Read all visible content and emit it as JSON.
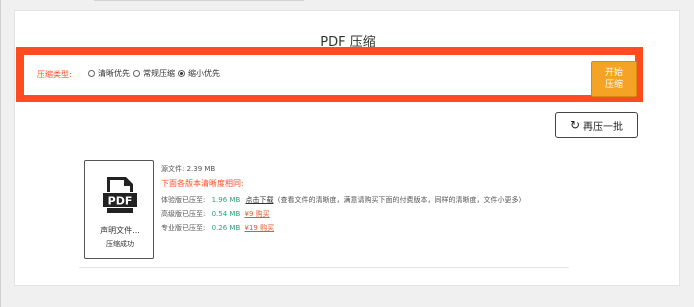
{
  "page": {
    "title": "PDF 压缩"
  },
  "options": {
    "label": "压缩类型:",
    "items": [
      {
        "label": "清晰优先",
        "checked": false
      },
      {
        "label": "常规压缩",
        "checked": false
      },
      {
        "label": "缩小优先",
        "checked": true
      }
    ],
    "start_line1": "开始",
    "start_line2": "压缩"
  },
  "recompress": {
    "icon": "refresh-icon",
    "label": "再压一批"
  },
  "file": {
    "icon": "pdf-file-icon",
    "icon_text": "PDF",
    "name": "声明文件...",
    "status": "压缩成功"
  },
  "results": {
    "source": "源文件: 2.39 MB",
    "notice": "下面各版本清晰度相同:",
    "rows": [
      {
        "label": "体验版已压至:",
        "size": "1.96 MB",
        "link": "点击下载",
        "note": "(查看文件的清晰度，满意请购买下面的付费版本，同样的清晰度，文件小更多)"
      },
      {
        "label": "高级版已压至:",
        "size": "0.54 MB",
        "buy": "¥9 购买"
      },
      {
        "label": "专业版已压至:",
        "size": "0.26 MB",
        "buy": "¥19 购买"
      }
    ]
  },
  "colors": {
    "accent": "#ff4c1f",
    "start_button": "#f4a324",
    "size_green": "#2aa37a"
  }
}
